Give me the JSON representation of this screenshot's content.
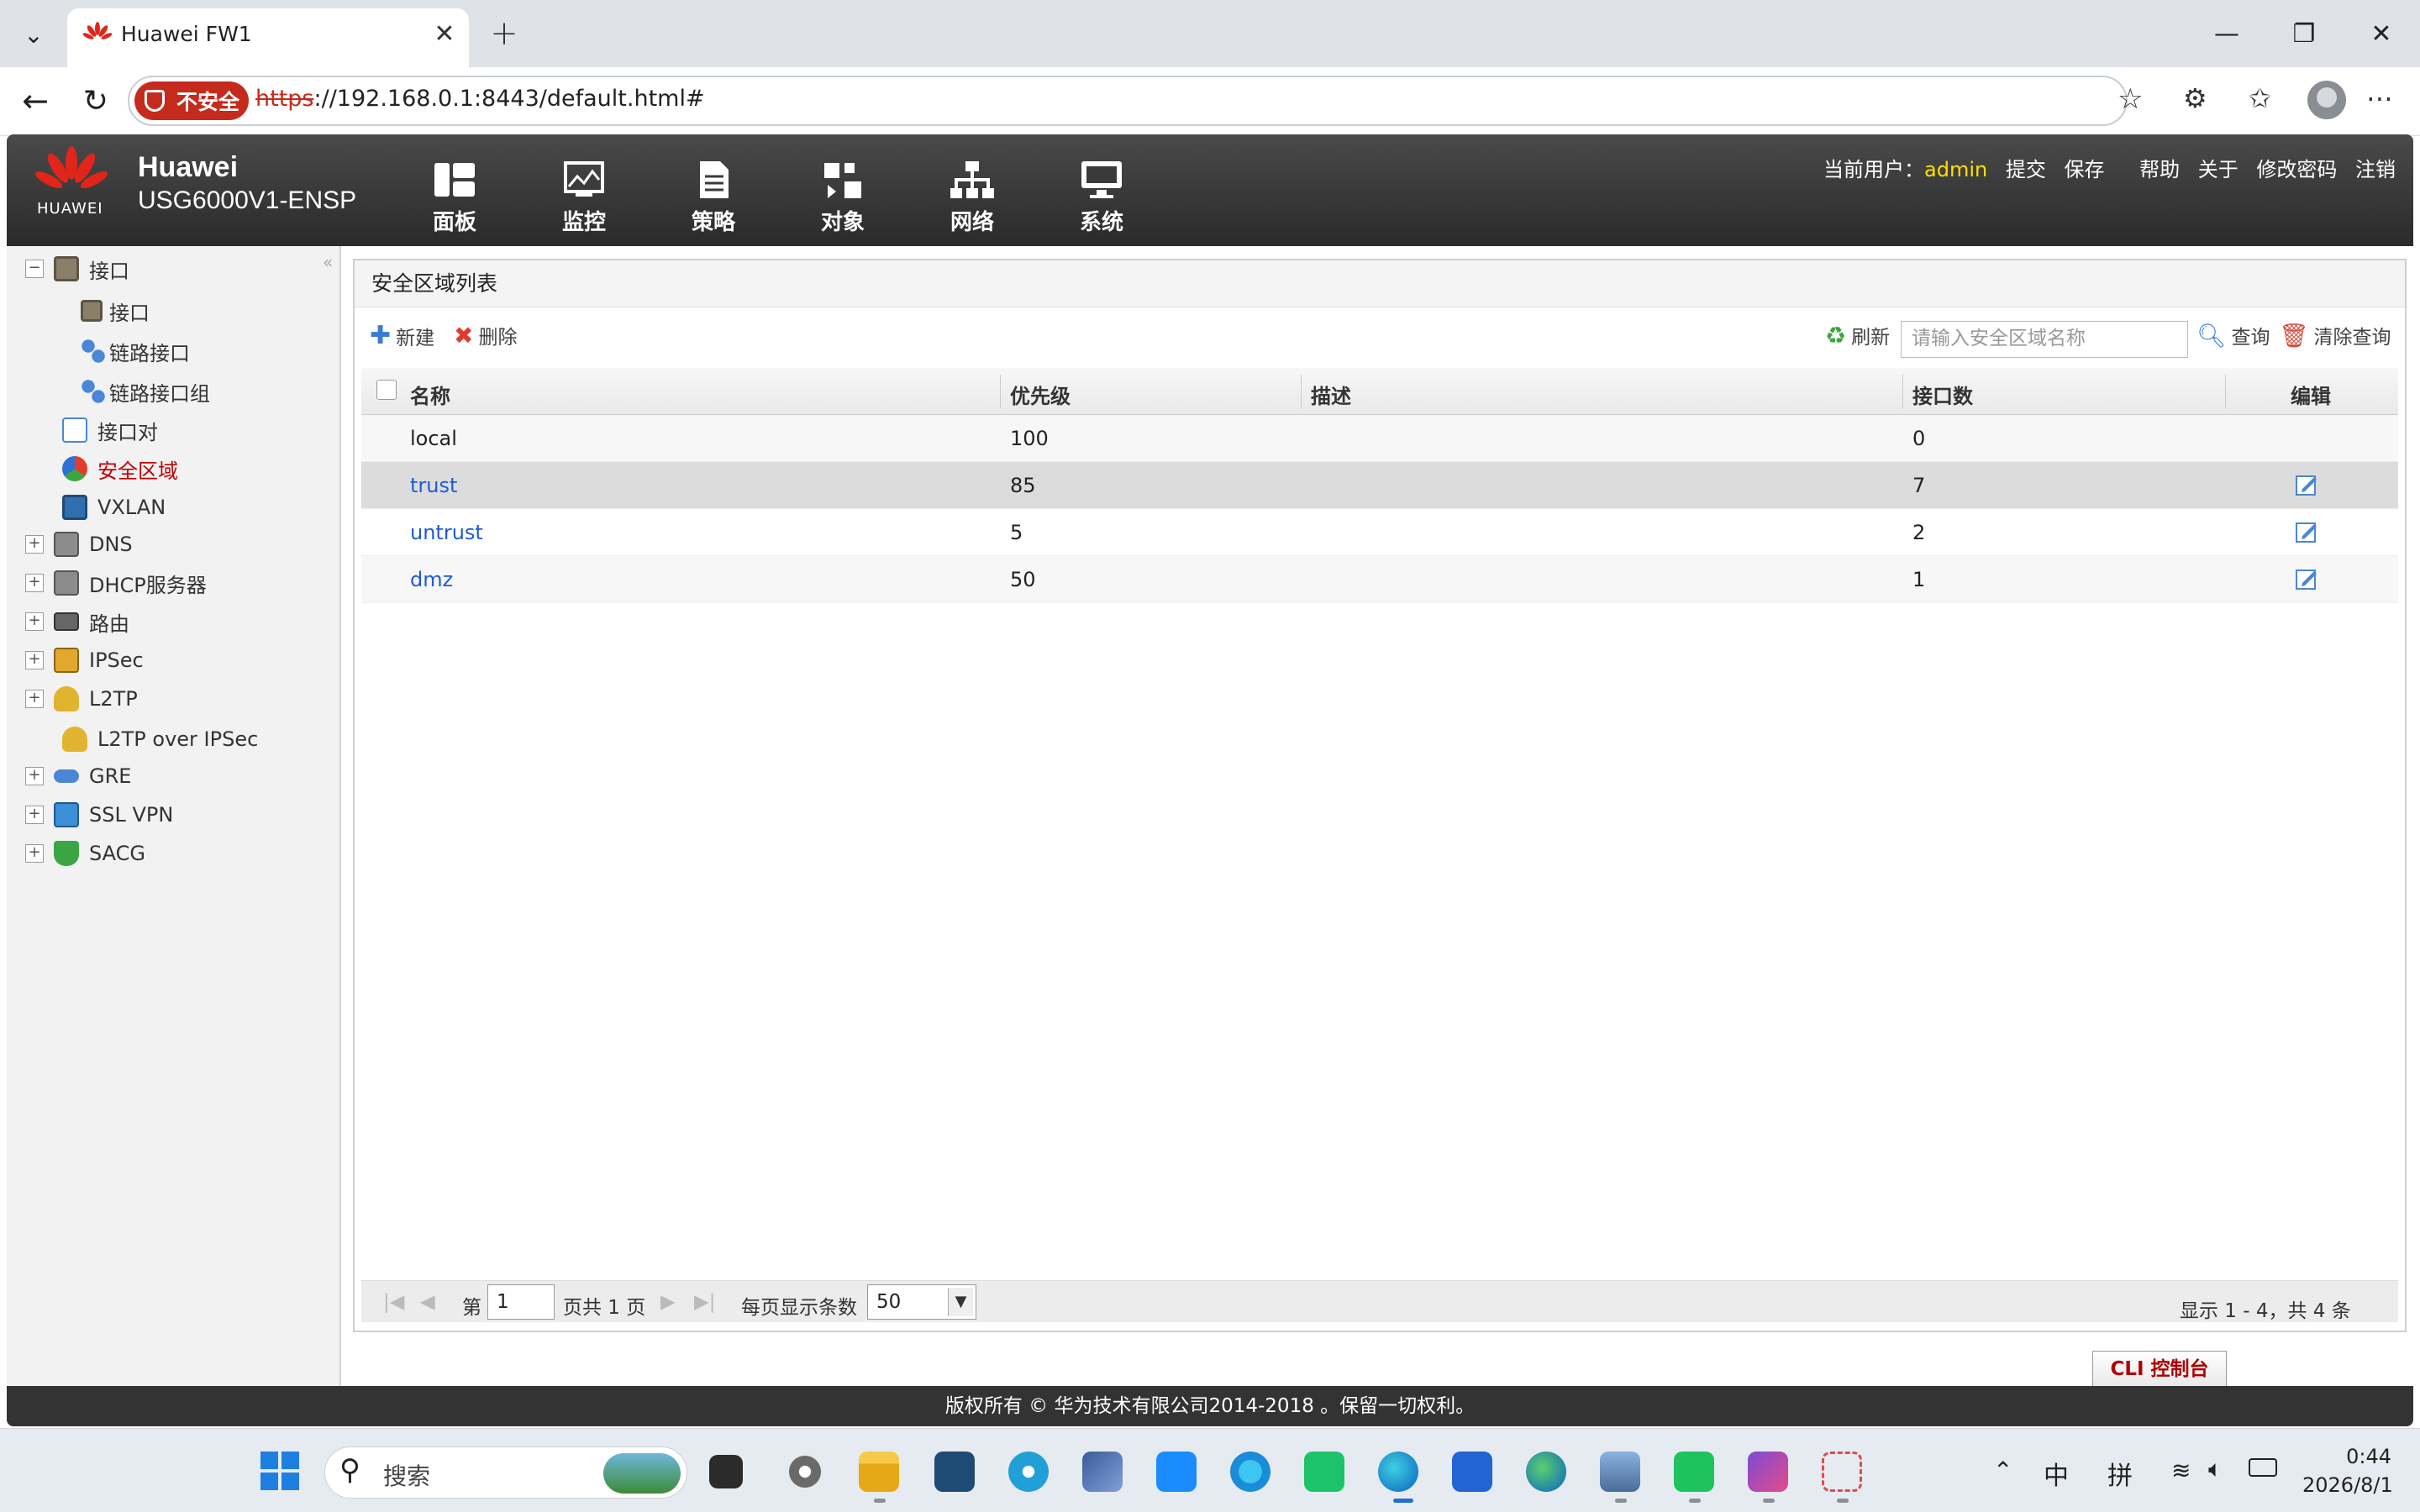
{
  "browser": {
    "tab_title": "Huawei FW1",
    "tab_close": "✕",
    "new_tab": "+",
    "security_label": "不安全",
    "url_scheme": "https",
    "url_rest": "://192.168.0.1:8443/default.html#",
    "win_min": "—",
    "win_restore": "❐",
    "win_close": "✕"
  },
  "app": {
    "logo_text": "HUAWEI",
    "brand": "Huawei",
    "model": "USG6000V1-ENSP",
    "nav": [
      {
        "label": "面板",
        "icon": "dashboard-icon"
      },
      {
        "label": "监控",
        "icon": "monitor-icon"
      },
      {
        "label": "策略",
        "icon": "policy-icon"
      },
      {
        "label": "对象",
        "icon": "object-icon"
      },
      {
        "label": "网络",
        "icon": "network-icon"
      },
      {
        "label": "系统",
        "icon": "system-icon"
      }
    ],
    "userbar": {
      "current_user_label": "当前用户：",
      "user": "admin",
      "commit": "提交",
      "save": "保存",
      "help": "帮助",
      "about": "关于",
      "change_password": "修改密码",
      "logout": "注销"
    }
  },
  "sidebar": {
    "items": [
      {
        "label": "接口",
        "expand": "−",
        "level": 0
      },
      {
        "label": "接口",
        "level": 1
      },
      {
        "label": "链路接口",
        "level": 1
      },
      {
        "label": "链路接口组",
        "level": 1
      },
      {
        "label": "接口对",
        "level": 0
      },
      {
        "label": "安全区域",
        "level": 0,
        "active": true
      },
      {
        "label": "VXLAN",
        "level": 0
      },
      {
        "label": "DNS",
        "expand": "+",
        "level": 0
      },
      {
        "label": "DHCP服务器",
        "expand": "+",
        "level": 0
      },
      {
        "label": "路由",
        "expand": "+",
        "level": 0
      },
      {
        "label": "IPSec",
        "expand": "+",
        "level": 0
      },
      {
        "label": "L2TP",
        "expand": "+",
        "level": 0
      },
      {
        "label": "L2TP over IPSec",
        "level": 0
      },
      {
        "label": "GRE",
        "expand": "+",
        "level": 0
      },
      {
        "label": "SSL VPN",
        "expand": "+",
        "level": 0
      },
      {
        "label": "SACG",
        "expand": "+",
        "level": 0
      }
    ]
  },
  "panel": {
    "title": "安全区域列表",
    "new": "新建",
    "delete": "删除",
    "refresh": "刷新",
    "search_placeholder": "请输入安全区域名称",
    "query": "查询",
    "clear_query": "清除查询"
  },
  "table": {
    "headers": {
      "name": "名称",
      "priority": "优先级",
      "desc": "描述",
      "ifcount": "接口数",
      "edit": "编辑"
    },
    "rows": [
      {
        "name": "local",
        "priority": "100",
        "desc": "",
        "ifcount": "0",
        "editable": false
      },
      {
        "name": "trust",
        "priority": "85",
        "desc": "",
        "ifcount": "7",
        "editable": true
      },
      {
        "name": "untrust",
        "priority": "5",
        "desc": "",
        "ifcount": "2",
        "editable": true
      },
      {
        "name": "dmz",
        "priority": "50",
        "desc": "",
        "ifcount": "1",
        "editable": true
      }
    ]
  },
  "pager": {
    "page_prefix": "第",
    "page": "1",
    "page_suffix": "页共 1 页",
    "per_page_label": "每页显示条数",
    "per_page": "50",
    "summary": "显示 1 - 4，共 4 条"
  },
  "cli_button": "CLI 控制台",
  "footer": "版权所有 © 华为技术有限公司2014-2018 。保留一切权利。",
  "taskbar": {
    "search_label": "搜索",
    "ime_lang": "中",
    "ime_mode": "拼",
    "time": "0:44",
    "date": "2026/8/1"
  }
}
